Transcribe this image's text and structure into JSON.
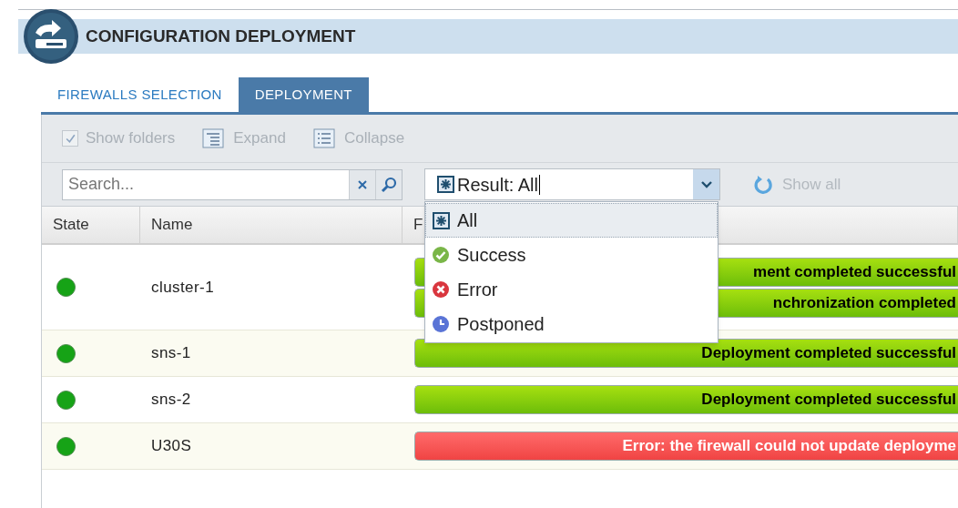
{
  "header": {
    "title": "CONFIGURATION DEPLOYMENT"
  },
  "tabs": [
    {
      "label": "FIREWALLS SELECTION",
      "selected": false
    },
    {
      "label": "DEPLOYMENT",
      "selected": true
    }
  ],
  "toolbar": {
    "show_folders": {
      "label": "Show folders",
      "checked": true,
      "disabled": true
    },
    "expand": {
      "label": "Expand",
      "disabled": true
    },
    "collapse": {
      "label": "Collapse",
      "disabled": true
    }
  },
  "search": {
    "placeholder": "Search..."
  },
  "filter": {
    "value": "Result: All",
    "expanded": true,
    "options": [
      {
        "label": "All",
        "kind": "all",
        "selected": true
      },
      {
        "label": "Success",
        "kind": "success",
        "selected": false
      },
      {
        "label": "Error",
        "kind": "error",
        "selected": false
      },
      {
        "label": "Postponed",
        "kind": "postponed",
        "selected": false
      }
    ]
  },
  "show_all": {
    "label": "Show all",
    "disabled": true
  },
  "table": {
    "columns": [
      "State",
      "Name",
      "F"
    ],
    "rows": [
      {
        "name": "cluster-1",
        "ok": true,
        "results": [
          {
            "kind": "success",
            "text": "ment completed successful"
          },
          {
            "kind": "success",
            "text": "nchronization completed"
          }
        ]
      },
      {
        "name": "sns-1",
        "ok": true,
        "results": [
          {
            "kind": "success",
            "text": "Deployment completed successful"
          }
        ]
      },
      {
        "name": "sns-2",
        "ok": true,
        "results": [
          {
            "kind": "success",
            "text": "Deployment completed successful"
          }
        ]
      },
      {
        "name": "U30S",
        "ok": true,
        "results": [
          {
            "kind": "error",
            "text": "Error: the firewall could not update deployme"
          }
        ]
      }
    ]
  }
}
